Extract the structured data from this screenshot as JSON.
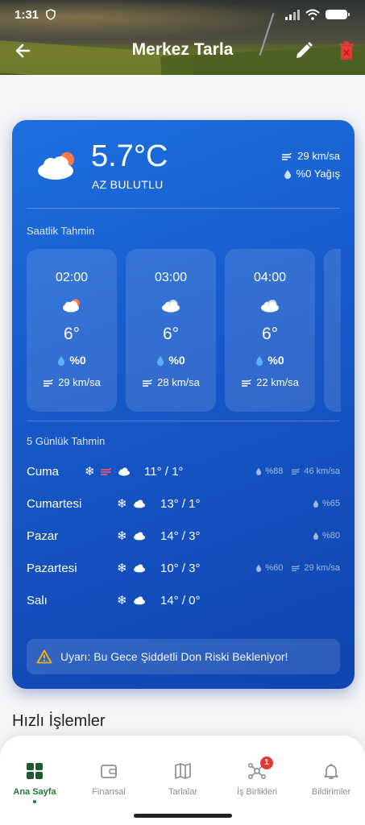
{
  "status_bar": {
    "time": "1:31"
  },
  "app_bar": {
    "title": "Merkez Tarla"
  },
  "current": {
    "temperature": "5.7°C",
    "condition": "AZ BULUTLU",
    "wind": "29 km/sa",
    "precipitation": "%0 Yağış"
  },
  "hourly": {
    "label": "Saatlik Tahmin",
    "items": [
      {
        "time": "02:00",
        "icon": "partly-cloudy-sun-icon",
        "temp": "6°",
        "rain": "%0",
        "wind": "29 km/sa"
      },
      {
        "time": "03:00",
        "icon": "cloud-icon",
        "temp": "6°",
        "rain": "%0",
        "wind": "28 km/sa"
      },
      {
        "time": "04:00",
        "icon": "cloud-icon",
        "temp": "6°",
        "rain": "%0",
        "wind": "22 km/sa"
      }
    ]
  },
  "daily": {
    "label": "5 Günlük Tahmin",
    "items": [
      {
        "day": "Cuma",
        "range": "11° / 1°",
        "rain": "%88",
        "wind": "46 km/sa",
        "icons": [
          "snowflake-icon",
          "wind-icon",
          "cloud-icon"
        ]
      },
      {
        "day": "Cumartesi",
        "range": "13° / 1°",
        "rain": "%65",
        "wind": "",
        "icons": [
          "snowflake-icon",
          "cloud-icon"
        ]
      },
      {
        "day": "Pazar",
        "range": "14° / 3°",
        "rain": "%80",
        "wind": "",
        "icons": [
          "snowflake-icon",
          "cloud-icon"
        ]
      },
      {
        "day": "Pazartesi",
        "range": "10° / 3°",
        "rain": "%60",
        "wind": "29 km/sa",
        "icons": [
          "snowflake-icon",
          "cloud-icon"
        ]
      },
      {
        "day": "Salı",
        "range": "14° / 0°",
        "rain": "",
        "wind": "",
        "icons": [
          "snowflake-icon",
          "cloud-icon"
        ]
      }
    ]
  },
  "alert": {
    "text": "Uyarı: Bu Gece Şiddetli Don Riski Bekleniyor!"
  },
  "quick_actions": {
    "title": "Hızlı İşlemler"
  },
  "bottom_nav": {
    "items": [
      {
        "label": "Ana Sayfa",
        "active": true
      },
      {
        "label": "Finansal"
      },
      {
        "label": "Tarlalar"
      },
      {
        "label": "İş Birlikleri",
        "badge": "1"
      },
      {
        "label": "Bildirimler"
      }
    ]
  },
  "colors": {
    "card": "#1758c8",
    "accent_green": "#1e7a3a",
    "delete_red": "#e53935",
    "badge_red": "#e53935"
  }
}
